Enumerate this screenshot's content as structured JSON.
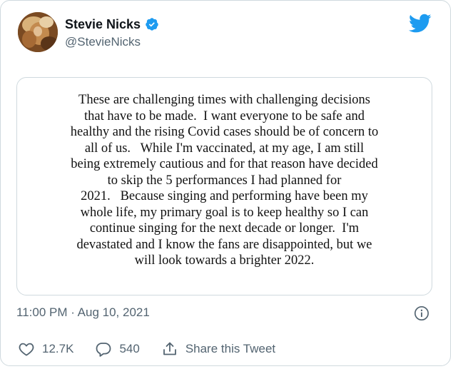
{
  "author": {
    "display_name": "Stevie Nicks",
    "handle": "@StevieNicks",
    "verified": true
  },
  "statement_lines": [
    "These are challenging times with challenging decisions",
    "that have to be made.  I want everyone to be safe and",
    "healthy and the rising Covid cases should be of concern to",
    "all of us.   While I'm vaccinated, at my age, I am still",
    "being extremely cautious and for that reason have decided",
    "to skip the 5 performances I had planned for",
    "2021.   Because singing and performing have been my",
    "whole life, my primary goal is to keep healthy so I can",
    "continue singing for the next decade or longer.  I'm",
    "devastated and I know the fans are disappointed, but we",
    "will look towards a brighter 2022."
  ],
  "timestamp": "11:00 PM · Aug 10, 2021",
  "actions": {
    "likes": "12.7K",
    "replies": "540",
    "share_label": "Share this Tweet"
  },
  "icons": {
    "twitter": "twitter-bird-icon",
    "verified": "verified-badge-icon",
    "info": "info-icon",
    "like": "heart-icon",
    "reply": "reply-icon",
    "share": "share-icon"
  },
  "colors": {
    "brand": "#1d9bf0",
    "text": "#0f1419",
    "secondary": "#536471",
    "border": "#cfd9de"
  }
}
